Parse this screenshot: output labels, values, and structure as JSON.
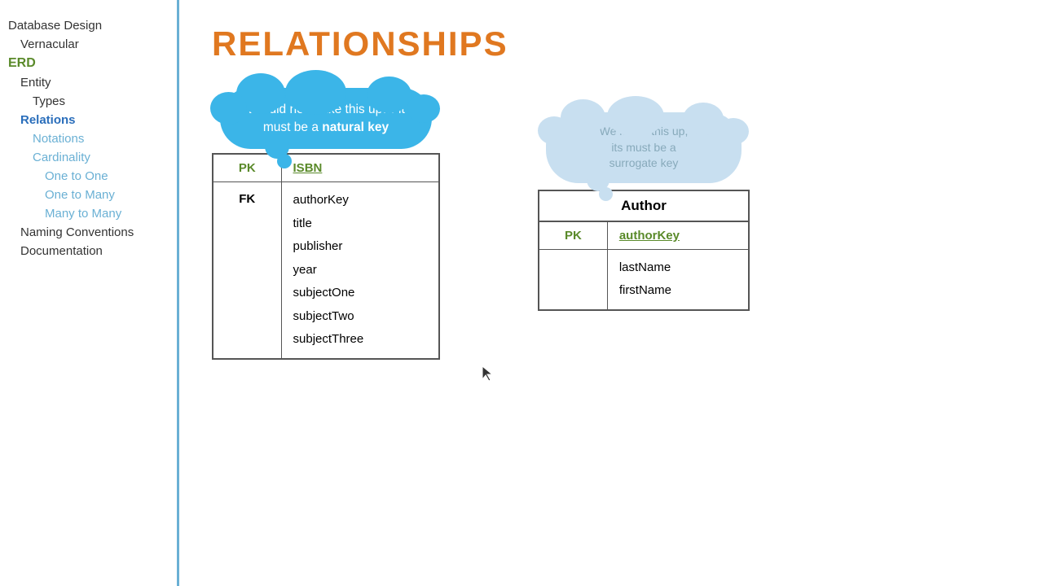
{
  "sidebar": {
    "items": [
      {
        "label": "Database Design",
        "class": "level0"
      },
      {
        "label": "Vernacular",
        "class": "level1"
      },
      {
        "label": "ERD",
        "class": "erd"
      },
      {
        "label": "Entity",
        "class": "entity"
      },
      {
        "label": "Types",
        "class": "types"
      },
      {
        "label": "Relations",
        "class": "relations"
      },
      {
        "label": "Notations",
        "class": "notations"
      },
      {
        "label": "Cardinality",
        "class": "cardinality"
      },
      {
        "label": "One to One",
        "class": "sub2"
      },
      {
        "label": "One to Many",
        "class": "sub2"
      },
      {
        "label": "Many to Many",
        "class": "sub2"
      },
      {
        "label": "Naming Conventions",
        "class": "naming"
      },
      {
        "label": "Documentation",
        "class": "documentation"
      }
    ]
  },
  "main": {
    "title": "RELATIONSHIPS",
    "left_cloud": {
      "text_before": "We did not make this up… it must be a ",
      "highlight": "natural key"
    },
    "right_cloud": {
      "line1": "We made this up,",
      "line2": "its must be a",
      "line3": "surrogate key"
    },
    "left_table": {
      "pk_label": "PK",
      "pk_value": "ISBN",
      "fk_label": "FK",
      "fields": [
        "authorKey",
        "title",
        "publisher",
        "year",
        "subjectOne",
        "subjectTwo",
        "subjectThree"
      ]
    },
    "right_table": {
      "header": "Author",
      "pk_label": "PK",
      "pk_value": "authorKey",
      "fields": [
        "lastName",
        "firstName"
      ]
    }
  }
}
